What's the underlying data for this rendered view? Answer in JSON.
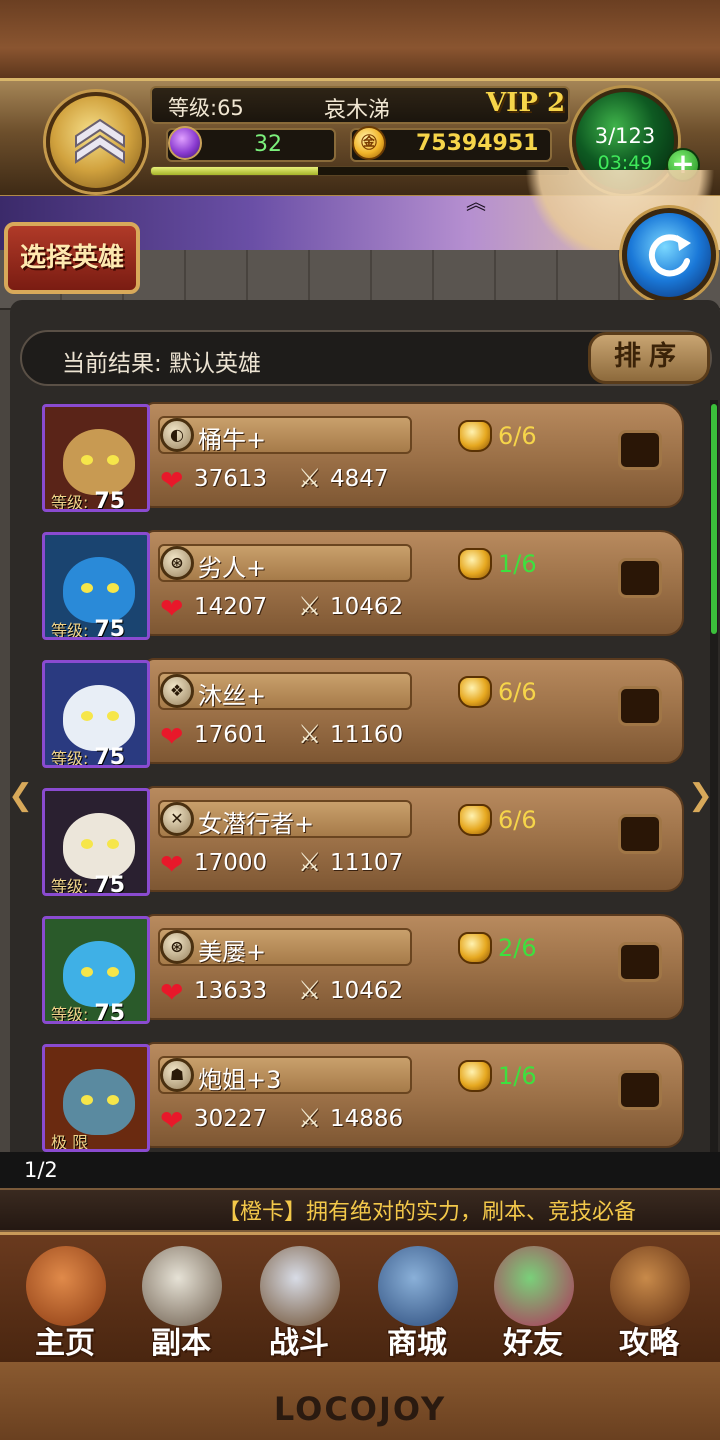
{
  "header": {
    "level_label": "等级:65",
    "player_name": "哀木涕",
    "vip": "VIP 2",
    "gems": "32",
    "gold": "75394951",
    "coin_glyph": "㊎",
    "energy": "3/123",
    "energy_timer": "03:49",
    "xp_progress": 0.4,
    "plus_label": "+"
  },
  "controls": {
    "select_hero": "选择英雄",
    "filter_label": "当前结果:  默认英雄",
    "sort": "排序"
  },
  "heroes": [
    {
      "name": "桶牛+",
      "level_label": "等级:",
      "level": "75",
      "hp": "37613",
      "atk": "4847",
      "equip": "6/6",
      "equip_color": "#f6d54a",
      "class_glyph": "◐"
    },
    {
      "name": "劣人+",
      "level_label": "等级:",
      "level": "75",
      "hp": "14207",
      "atk": "10462",
      "equip": "1/6",
      "equip_color": "#3ee03e",
      "class_glyph": "⊛"
    },
    {
      "name": "沐丝+",
      "level_label": "等级:",
      "level": "75",
      "hp": "17601",
      "atk": "11160",
      "equip": "6/6",
      "equip_color": "#f6d54a",
      "class_glyph": "❖"
    },
    {
      "name": "女潜行者+",
      "level_label": "等级:",
      "level": "75",
      "hp": "17000",
      "atk": "11107",
      "equip": "6/6",
      "equip_color": "#f6d54a",
      "class_glyph": "✕"
    },
    {
      "name": "美屡+",
      "level_label": "等级:",
      "level": "75",
      "hp": "13633",
      "atk": "10462",
      "equip": "2/6",
      "equip_color": "#3ee03e",
      "class_glyph": "⊛"
    },
    {
      "name": "炮姐+3",
      "level_label": "极 限",
      "level": "",
      "hp": "30227",
      "atk": "14886",
      "equip": "1/6",
      "equip_color": "#3ee03e",
      "class_glyph": "☗"
    }
  ],
  "pagination": {
    "page": "1/2"
  },
  "ticker": "【橙卡】拥有绝对的实力，刷本、竞技必备",
  "nav": [
    {
      "label": "主页",
      "icon": "house-icon"
    },
    {
      "label": "副本",
      "icon": "skull-icon"
    },
    {
      "label": "战斗",
      "icon": "swords-icon"
    },
    {
      "label": "商城",
      "icon": "shop-icon"
    },
    {
      "label": "好友",
      "icon": "friends-icon"
    },
    {
      "label": "攻略",
      "icon": "book-icon"
    }
  ],
  "logo": "LOCOJOY",
  "icons": {
    "heart": "❤",
    "sword": "⚔",
    "arrow_left": "❮",
    "arrow_right": "❯",
    "bat": "︽"
  }
}
